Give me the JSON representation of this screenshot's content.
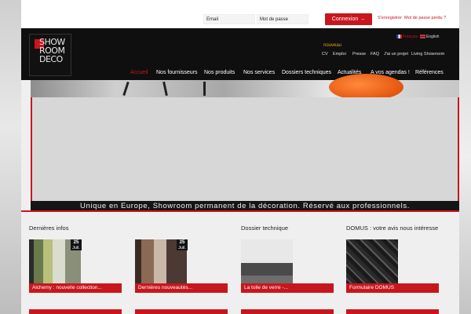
{
  "login": {
    "email_label": "Email",
    "password_label": "Mot de passe",
    "button_label": "Connexion →",
    "register_label": "S'enregistrer",
    "forgot_label": "Mot de passe perdu ?"
  },
  "logo": {
    "lines": [
      "SHOW",
      "ROOM",
      "DECO"
    ]
  },
  "languages": [
    {
      "label": "Français"
    },
    {
      "label": "English"
    }
  ],
  "subnav": {
    "new_badge": "nouveau",
    "items": [
      "CV",
      "Emploi",
      "Presse",
      "FAQ",
      "J'ai un projet",
      "Living Showroom"
    ]
  },
  "mainnav": {
    "items": [
      "Accueil",
      "Nos fournisseurs",
      "Nos produits",
      "Nos services",
      "Dossiers techniques",
      "Actualités",
      "A vos agendas !",
      "Références"
    ],
    "active": "Accueil"
  },
  "slider": {
    "tagline": "Unique en Europe, Showroom permanent de la décoration. Réservé aux professionnels."
  },
  "sections": {
    "news_title": "Dernières infos",
    "tech_title": "Dossier technique",
    "domus_title": "DOMUS : votre avis nous intéresse"
  },
  "cards": [
    {
      "caption": "Alchemy : nouvelle collection...",
      "day": "25",
      "month": "Juil."
    },
    {
      "caption": "Dernières nouveautés...",
      "day": "25",
      "month": "Juil."
    },
    {
      "caption": "La toile de verre -...",
      "day": "",
      "month": ""
    },
    {
      "caption": "Formulaire DOMUS",
      "day": "",
      "month": ""
    }
  ],
  "colors": {
    "accent": "#c8161d",
    "header_bg": "#0f0f0f"
  }
}
